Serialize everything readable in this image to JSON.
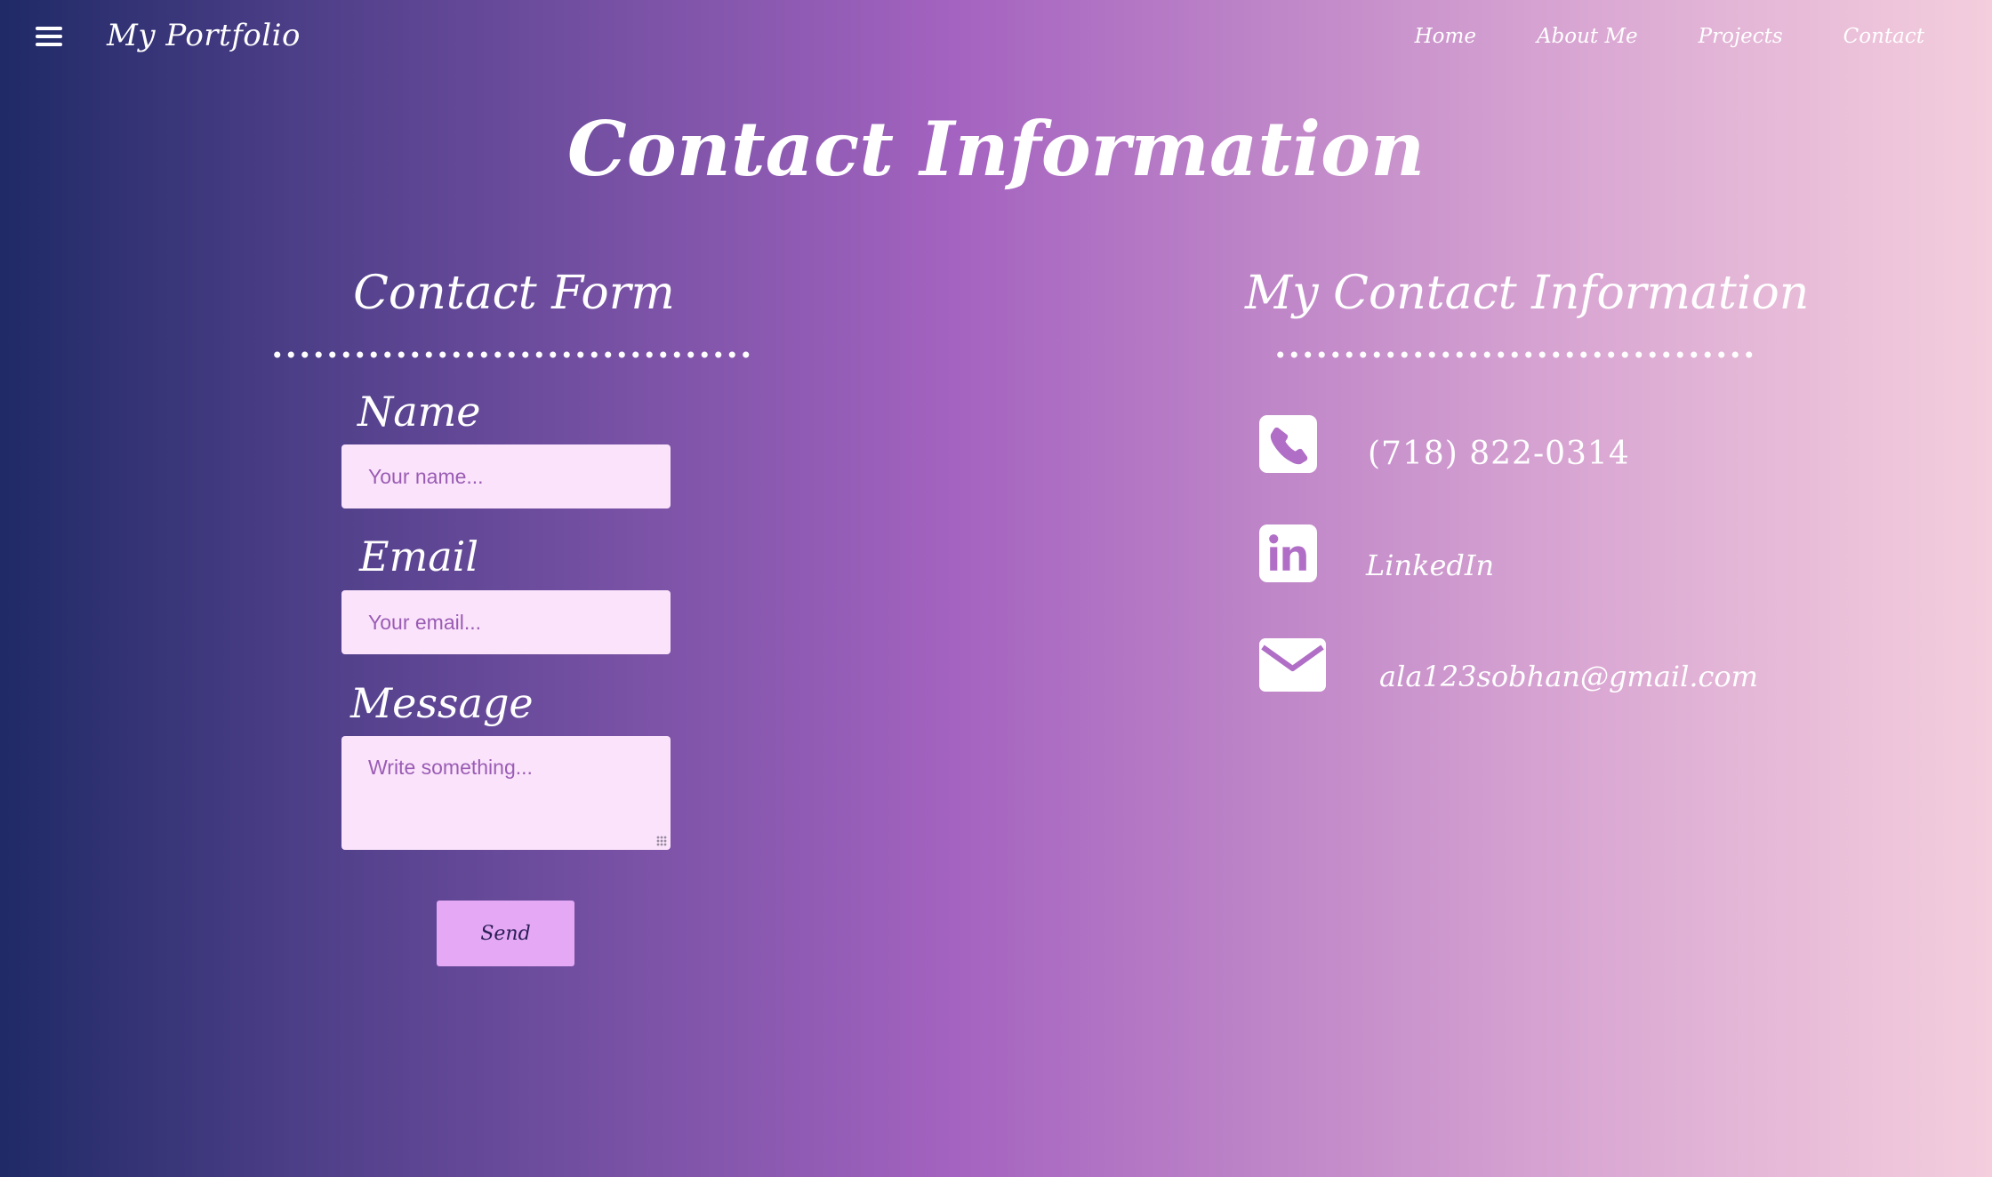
{
  "header": {
    "brand": "My Portfolio",
    "nav": [
      "Home",
      "About Me",
      "Projects",
      "Contact"
    ]
  },
  "page": {
    "title": "Contact Information"
  },
  "contact_form": {
    "title": "Contact Form",
    "name_label": "Name",
    "name_placeholder": "Your name...",
    "email_label": "Email",
    "email_placeholder": "Your email...",
    "message_label": "Message",
    "message_placeholder": "Write something...",
    "send_label": "Send"
  },
  "contact_info": {
    "title": "My Contact Information",
    "phone": "(718) 822-0314",
    "linkedin": "LinkedIn",
    "email": "ala123sobhan@gmail.com",
    "icons": [
      "phone-icon",
      "linkedin-icon",
      "envelope-icon"
    ]
  },
  "colors": {
    "accent_icon": "#b06ec6",
    "field_bg": "#fbe4fb",
    "button_bg": "#e5a8f5",
    "button_text": "#2a1d55"
  }
}
